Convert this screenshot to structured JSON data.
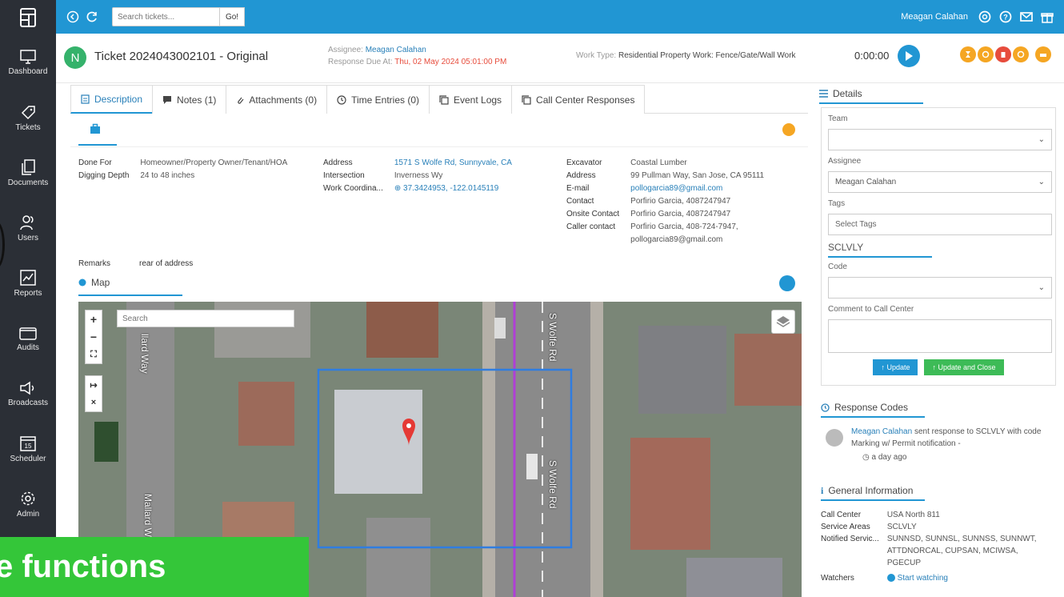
{
  "sidebar": {
    "items": [
      {
        "label": "Dashboard",
        "icon": "monitor-icon"
      },
      {
        "label": "Tickets",
        "icon": "tag-icon"
      },
      {
        "label": "Documents",
        "icon": "documents-icon"
      },
      {
        "label": "Users",
        "icon": "users-icon"
      },
      {
        "label": "Reports",
        "icon": "chart-icon"
      },
      {
        "label": "Audits",
        "icon": "folder-icon"
      },
      {
        "label": "Broadcasts",
        "icon": "megaphone-icon"
      },
      {
        "label": "Scheduler",
        "icon": "calendar-icon"
      },
      {
        "label": "Admin",
        "icon": "gear-icon"
      }
    ],
    "calendar_day": "15"
  },
  "topbar": {
    "search_placeholder": "Search tickets...",
    "go_label": "Go!",
    "user_name": "Meagan Calahan"
  },
  "ticket": {
    "avatar_letter": "N",
    "title": "Ticket 2024043002101 - Original",
    "assignee_label": "Assignee:",
    "assignee_value": "Meagan Calahan",
    "due_label": "Response Due At:",
    "due_value": "Thu, 02 May 2024 05:01:00 PM",
    "work_type_label": "Work Type:",
    "work_type_value": "Residential Property Work: Fence/Gate/Wall Work",
    "timer": "0:00:00"
  },
  "tabs": [
    {
      "label": "Description",
      "icon": "description-icon",
      "active": true
    },
    {
      "label": "Notes (1)",
      "icon": "notes-icon",
      "active": false
    },
    {
      "label": "Attachments (0)",
      "icon": "paperclip-icon",
      "active": false
    },
    {
      "label": "Time Entries (0)",
      "icon": "clock-icon",
      "active": false
    },
    {
      "label": "Event Logs",
      "icon": "copy-icon",
      "active": false
    },
    {
      "label": "Call Center Responses",
      "icon": "copy-icon",
      "active": false
    }
  ],
  "description": {
    "col1": [
      {
        "key": "Done For",
        "value": "Homeowner/Property Owner/Tenant/HOA"
      },
      {
        "key": "Digging Depth",
        "value": "24 to 48 inches"
      }
    ],
    "col2": [
      {
        "key": "Address",
        "value": "1571 S Wolfe Rd, Sunnyvale, CA"
      },
      {
        "key": "Intersection",
        "value": "Inverness Wy"
      },
      {
        "key": "Work Coordina...",
        "value": "⊕ 37.3424953, -122.0145119"
      }
    ],
    "col3": [
      {
        "key": "Excavator",
        "value": "Coastal Lumber"
      },
      {
        "key": "Address",
        "value": "99 Pullman Way, San Jose, CA 95111"
      },
      {
        "key": "E-mail",
        "value": "pollogarcia89@gmail.com"
      },
      {
        "key": "Contact",
        "value": "Porfirio Garcia, 4087247947"
      },
      {
        "key": "Onsite Contact",
        "value": "Porfirio Garcia, 4087247947"
      },
      {
        "key": "Caller contact",
        "value": "Porfirio Garcia, 408-724-7947,"
      },
      {
        "key": "",
        "value": "pollogarcia89@gmail.com"
      }
    ],
    "remarks_label": "Remarks",
    "remarks_value": "rear of address",
    "map_label": "Map"
  },
  "map": {
    "search_placeholder": "Search",
    "controls": [
      "+",
      "−",
      "⛶",
      "↦",
      "×"
    ],
    "streets": [
      "llard Way",
      "S Wolfe Rd",
      "S Wolfe Rd",
      "Mallard W"
    ]
  },
  "details": {
    "title": "Details",
    "team_label": "Team",
    "team_value": "",
    "assignee_label": "Assignee",
    "assignee_value": "Meagan Calahan",
    "tags_label": "Tags",
    "tags_placeholder": "Select Tags",
    "section": "SCLVLY",
    "code_label": "Code",
    "code_value": "",
    "comment_label": "Comment to Call Center",
    "update_label": "Update",
    "update_close_label": "Update and Close"
  },
  "response_codes": {
    "title": "Response Codes",
    "user": "Meagan Calahan",
    "text": "sent response to SCLVLY with code Marking w/ Permit notification -",
    "time": "a day ago"
  },
  "general": {
    "title": "General Information",
    "rows": [
      {
        "key": "Call Center",
        "value": "USA North 811"
      },
      {
        "key": "Service Areas",
        "value": "SCLVLY"
      },
      {
        "key": "Notified Servic...",
        "value": "SUNNSD, SUNNSL, SUNNSS, SUNNWT, ATTDNORCAL, CUPSAN, MCIWSA, PGECUP"
      }
    ],
    "watchers_label": "Watchers",
    "watchers_value": "Start watching"
  },
  "banner": "e functions",
  "colors": {
    "primary": "#2196d3",
    "sidebar": "#2b2f36",
    "banner": "#34c639",
    "avatar": "#35b26b",
    "due": "#e74c3c",
    "orange": "#f5a623"
  }
}
